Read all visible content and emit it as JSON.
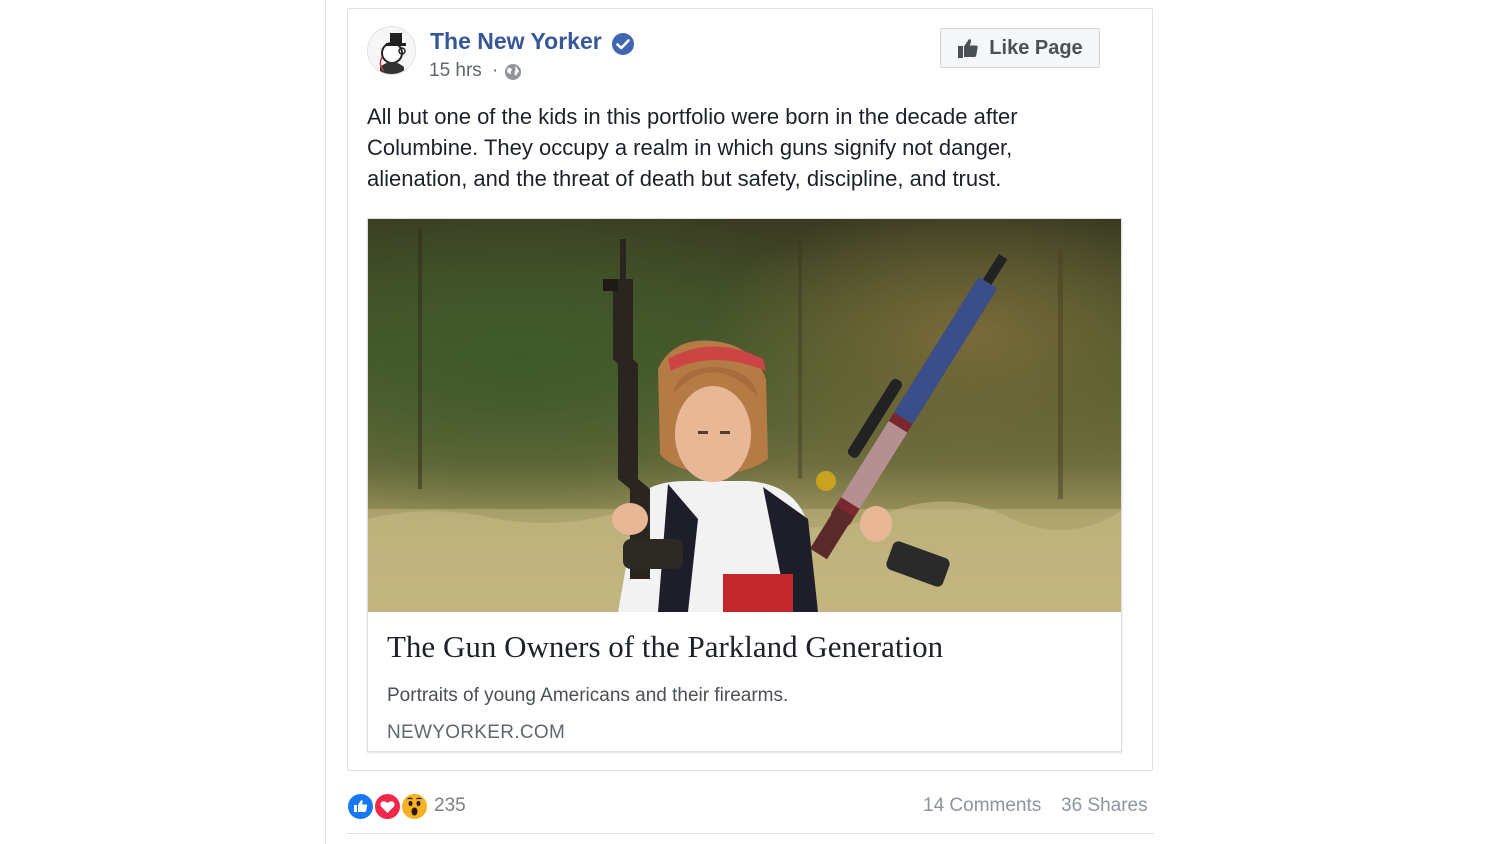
{
  "post": {
    "page_name": "The New Yorker",
    "verified": true,
    "timestamp": "15 hrs",
    "separator": "·",
    "audience_icon": "globe-icon",
    "like_button_label": "Like Page",
    "text": "All but one of the kids in this portfolio were born in the decade after Columbine. They occupy a realm in which guns signify not danger, alienation, and the threat of death but safety, discipline, and trust."
  },
  "link": {
    "title": "The Gun Owners of the Parkland Generation",
    "description": "Portraits of young Americans and their firearms.",
    "domain": "NEWYORKER.COM"
  },
  "engagement": {
    "reactions": [
      "like-reaction-icon",
      "love-reaction-icon",
      "wow-reaction-icon"
    ],
    "reaction_count": "235",
    "comments": "14 Comments",
    "shares": "36 Shares"
  },
  "colors": {
    "link_blue": "#365899",
    "verified_blue": "#4267b2",
    "like_blue": "#1877f2",
    "love_red": "#f0284a",
    "wow_yellow": "#f7b125"
  }
}
